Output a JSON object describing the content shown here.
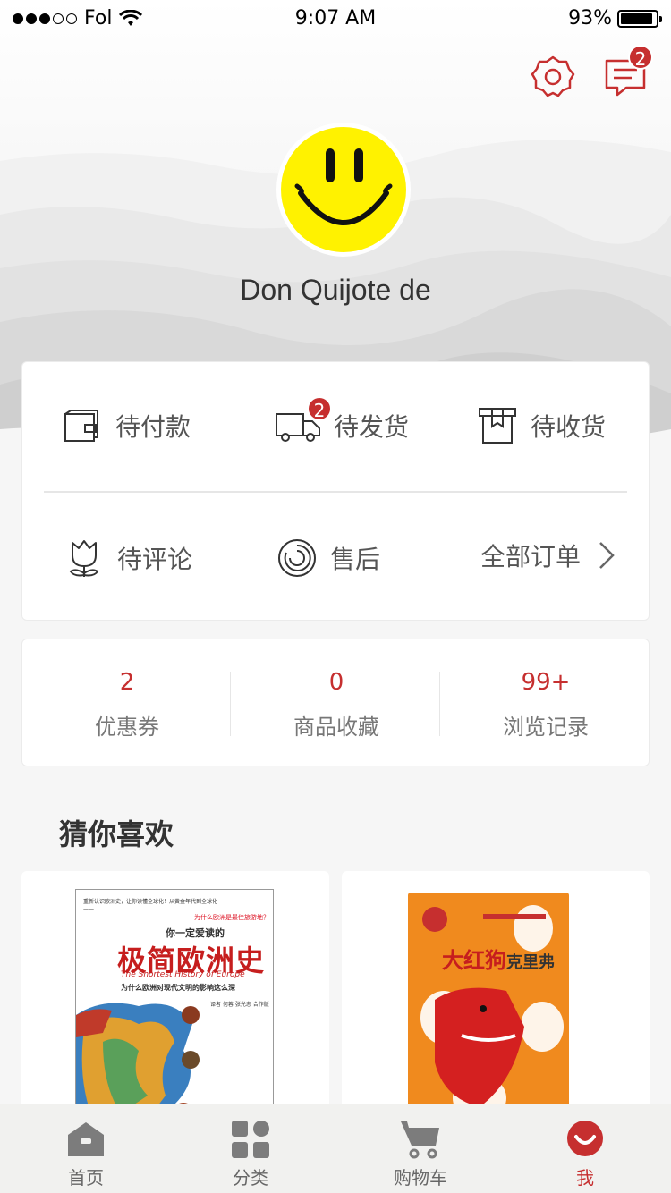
{
  "status_bar": {
    "carrier": "Fol",
    "time": "9:07 AM",
    "battery_percent": "93%",
    "battery_level": 0.93
  },
  "header": {
    "settings_icon": "gear-icon",
    "messages_icon": "message-icon",
    "messages_badge": "2"
  },
  "profile": {
    "avatar_icon": "smiley-face",
    "username": "Don Quijote de"
  },
  "orders": {
    "pending_payment": "待付款",
    "pending_shipment": "待发货",
    "pending_shipment_badge": "2",
    "pending_receipt": "待收货",
    "pending_review": "待评论",
    "after_sales": "售后",
    "all_orders": "全部订单"
  },
  "stats": [
    {
      "value": "2",
      "label": "优惠券"
    },
    {
      "value": "0",
      "label": "商品收藏"
    },
    {
      "value": "99+",
      "label": "浏览记录"
    }
  ],
  "recommend": {
    "title": "猜你喜欢",
    "products": [
      {
        "cover_small_text": "重新认识欧洲史，让你读懂全球化！从黄金年代到全球化——",
        "cover_red_text": "为什么欧洲是最佳旅游地？",
        "cover_subtitle": "你一定爱读的",
        "cover_title": "极简欧洲史",
        "cover_english": "The Shortest History of Europe",
        "cover_desc": "为什么欧洲对现代文明的影响这么深",
        "cover_meta": "译者 何蓉 张光忠 合作版"
      },
      {
        "cover_title": "大红狗",
        "cover_title2": "克里弗"
      }
    ]
  },
  "tabs": [
    {
      "label": "首页",
      "icon": "home-icon"
    },
    {
      "label": "分类",
      "icon": "grid-icon"
    },
    {
      "label": "购物车",
      "icon": "cart-icon"
    },
    {
      "label": "我",
      "icon": "me-icon",
      "active": true
    }
  ],
  "colors": {
    "accent": "#c62f2f",
    "background": "#f6f6f6",
    "avatar_yellow": "#fff200"
  }
}
